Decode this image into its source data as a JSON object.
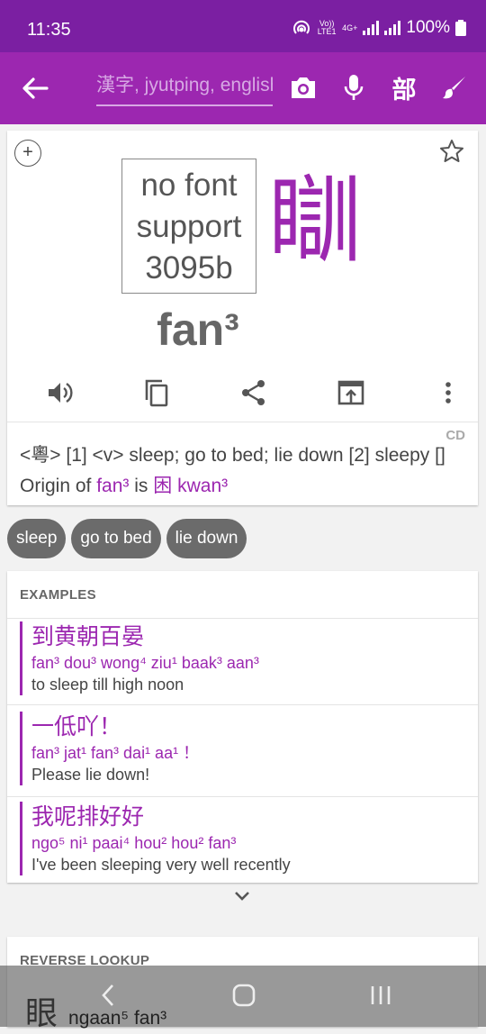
{
  "status_bar": {
    "time": "11:35",
    "volte": "Vo)) LTE1",
    "network": "4G+",
    "battery": "100%"
  },
  "app_bar": {
    "search_placeholder": "漢字, jyutping, english",
    "radical_label": "部"
  },
  "entry": {
    "no_font_lines": [
      "no font",
      "support",
      "3095b"
    ],
    "character": "瞓",
    "jyutping": "fan³",
    "source": "CD",
    "definition_prefix": "<粵> [1] <v> sleep; go to bed; lie down [2] sleepy []",
    "origin_label": "Origin of",
    "origin_char": "",
    "origin_jyutping": "fan³",
    "origin_is": "is",
    "origin_target": "困 kwan³"
  },
  "chips": [
    "sleep",
    "go to bed",
    "lie down"
  ],
  "examples": {
    "title": "EXAMPLES",
    "items": [
      {
        "chinese": "到黄朝百晏",
        "jyutping": "fan³ dou³ wong⁴ ziu¹ baak³ aan³",
        "english": "to sleep till high noon"
      },
      {
        "chinese": "一低吖！",
        "jyutping": "fan³ jat¹ fan³ dai¹ aa¹ ！",
        "english": "Please lie down!"
      },
      {
        "chinese": "我呢排好好",
        "jyutping": "ngo⁵ ni¹ paai⁴ hou² hou² fan³",
        "english": "I've been sleeping very well recently"
      }
    ]
  },
  "reverse_lookup": {
    "title": "REVERSE LOOKUP",
    "char": "眼",
    "missing_char": "",
    "jyutping": "ngaan⁵ fan³"
  },
  "colors": {
    "primary": "#9c27b0",
    "primary_dark": "#7b1fa2"
  },
  "icons": [
    "back-arrow-icon",
    "camera-icon",
    "microphone-icon",
    "brush-icon",
    "plus-icon",
    "star-icon",
    "speaker-icon",
    "copy-icon",
    "share-icon",
    "open-external-icon",
    "more-vert-icon",
    "chevron-down-icon"
  ]
}
